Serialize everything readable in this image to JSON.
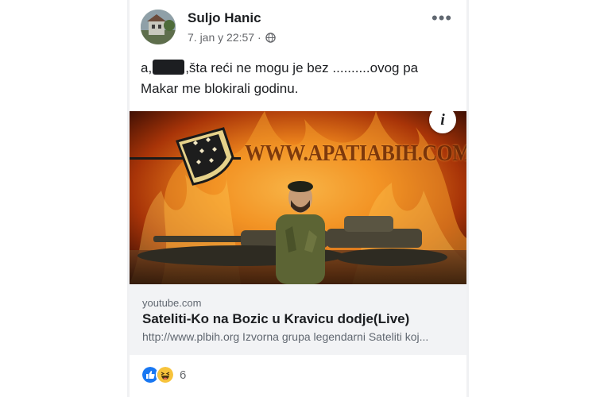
{
  "colors": {
    "page_background": "#f0f1f3",
    "card_meta_background": "#f2f3f5",
    "text_primary": "#1c1e21",
    "text_secondary": "#65676b",
    "like_blue": "#1877f2",
    "haha_yellow": "#f7c33b"
  },
  "post": {
    "author": "Suljo Hanic",
    "timestamp": "7. jan у 22:57 ·",
    "privacy_icon": "globe-icon",
    "more_icon": "more-options-icon",
    "text_prefix": "a,",
    "text_body": ",šta reći ne mogu je bez ..........ovog pa Makar me blokirali godinu."
  },
  "link_preview": {
    "watermark": "WWW.APATIABIH.COM",
    "info_label": "i",
    "domain": "youtube.com",
    "title": "Sateliti-Ko na Bozic u Kravicu dodje(Live)",
    "description": "http://www.plbih.org Izvorna grupa legendarni Sateliti koj..."
  },
  "reactions": {
    "icons": [
      "like-icon",
      "haha-icon"
    ],
    "count": "6"
  }
}
